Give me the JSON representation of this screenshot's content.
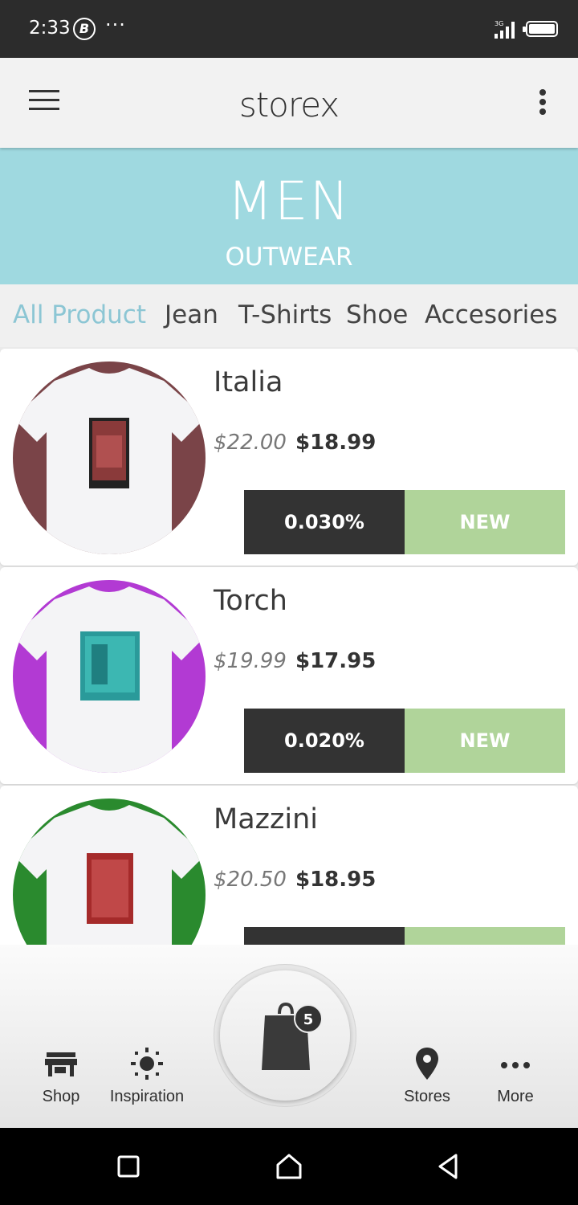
{
  "status_bar": {
    "time": "2:33",
    "b_icon": "B",
    "dots": "···"
  },
  "app_bar": {
    "title": "storex"
  },
  "banner": {
    "title": "MEN",
    "subtitle": "OUTWEAR"
  },
  "tabs": [
    {
      "label": "All Product",
      "active": true
    },
    {
      "label": "Jean"
    },
    {
      "label": "T-Shirts"
    },
    {
      "label": "Shoe"
    },
    {
      "label": "Accesories"
    }
  ],
  "products": [
    {
      "name": "Italia",
      "old_price": "$22.00",
      "price": "$18.99",
      "discount": "0.030%",
      "badge": "NEW",
      "color": "#7a4448"
    },
    {
      "name": "Torch",
      "old_price": "$19.99",
      "price": "$17.95",
      "discount": "0.020%",
      "badge": "NEW",
      "color": "#b23ad3"
    },
    {
      "name": "Mazzini",
      "old_price": "$20.50",
      "price": "$18.95",
      "discount": "",
      "badge": "",
      "color": "#2a8a2e"
    }
  ],
  "bottom_nav": {
    "shop": "Shop",
    "inspiration": "Inspiration",
    "stores": "Stores",
    "more": "More",
    "cart_count": "5"
  },
  "colors": {
    "banner": "#9fd9e0",
    "active_tab": "#8cc6d4",
    "badge": "#b0d49a",
    "discount": "#333333"
  }
}
